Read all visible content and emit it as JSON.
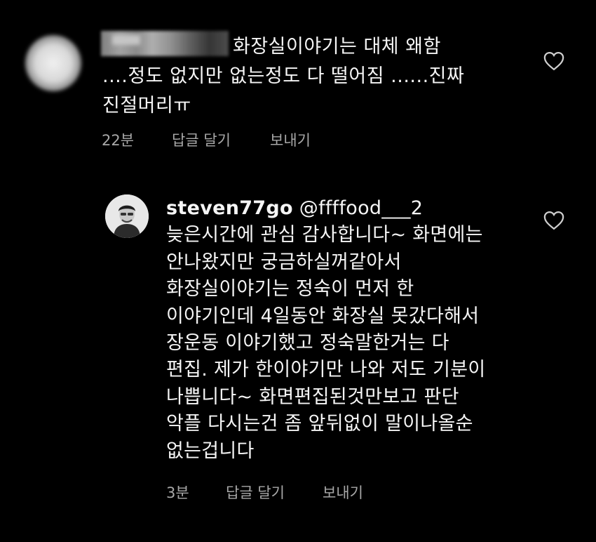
{
  "comment1": {
    "username_redacted": true,
    "lines": [
      "화장실이야기는 대체 왜함",
      "....정도 없지만 없는정도 다 떨어짐 ......진짜",
      "진절머리ㅠ"
    ],
    "time": "22분",
    "reply_label": "답글 달기",
    "send_label": "보내기"
  },
  "comment2": {
    "username": "steven77go",
    "mention": "@ffffood___2",
    "lines": [
      "늦은시간에 관심 감사합니다~ 화면에는",
      "안나왔지만 궁금하실꺼같아서",
      "화장실이야기는 정숙이 먼저 한",
      "이야기인데 4일동안 화장실 못갔다해서",
      "장운동 이야기했고 정숙말한거는 다",
      "편집. 제가 한이야기만 나와 저도 기분이",
      "나쁩니다~ 화면편집된것만보고 판단",
      "악플 다시는건 좀 앞뒤없이 말이나올순",
      "없는겁니다"
    ],
    "time": "3분",
    "reply_label": "답글 달기",
    "send_label": "보내기"
  },
  "icons": {
    "like": "heart-outline-icon"
  },
  "colors": {
    "background": "#000000",
    "text": "#f5f5f5",
    "meta": "#a8a8a8"
  }
}
